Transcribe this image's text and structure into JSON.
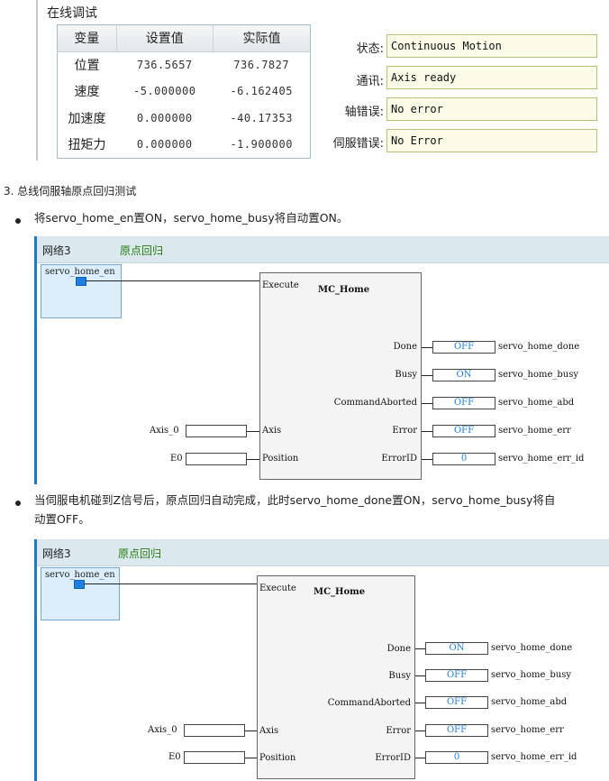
{
  "online": {
    "title": "在线调试",
    "table": {
      "headers": [
        "变量",
        "设置值",
        "实际值"
      ],
      "rows": [
        {
          "name": "位置",
          "set": "736.5657",
          "actual": "736.7827"
        },
        {
          "name": "速度",
          "set": "-5.000000",
          "actual": "-6.162405"
        },
        {
          "name": "加速度",
          "set": "0.000000",
          "actual": "-40.17353"
        },
        {
          "name": "扭矩力",
          "set": "0.000000",
          "actual": "-1.900000"
        }
      ]
    },
    "status": [
      {
        "label": "状态:",
        "value": "Continuous Motion"
      },
      {
        "label": "通讯:",
        "value": "Axis ready"
      },
      {
        "label": "轴错误:",
        "value": "No error"
      },
      {
        "label": "伺服错误:",
        "value": "No Error"
      }
    ]
  },
  "section3_heading": "3. 总线伺服轴原点回归测试",
  "bullets": [
    "将servo_home_en置ON，servo_home_busy将自动置ON。",
    "当伺服电机碰到Z信号后，原点回归自动完成，此时servo_home_done置ON，servo_home_busy将自",
    "动置OFF。"
  ],
  "diagrams": [
    {
      "network": "网络3",
      "comment": "原点回归",
      "contact": "servo_home_en",
      "block_name": "MC_Home",
      "execute_pin": "Execute",
      "inputs": [
        {
          "pin": "Axis",
          "var": "Axis_0"
        },
        {
          "pin": "Position",
          "var": "E0"
        }
      ],
      "outputs": [
        {
          "pin": "Done",
          "value": "OFF",
          "var": "servo_home_done"
        },
        {
          "pin": "Busy",
          "value": "ON",
          "var": "servo_home_busy"
        },
        {
          "pin": "CommandAborted",
          "value": "OFF",
          "var": "servo_home_abd"
        },
        {
          "pin": "Error",
          "value": "OFF",
          "var": "servo_home_err"
        },
        {
          "pin": "ErrorID",
          "value": "0",
          "var": "servo_home_err_id"
        }
      ]
    },
    {
      "network": "网络3",
      "comment": "原点回归",
      "contact": "servo_home_en",
      "block_name": "MC_Home",
      "execute_pin": "Execute",
      "inputs": [
        {
          "pin": "Axis",
          "var": "Axis_0"
        },
        {
          "pin": "Position",
          "var": "E0"
        }
      ],
      "outputs": [
        {
          "pin": "Done",
          "value": "ON",
          "var": "servo_home_done"
        },
        {
          "pin": "Busy",
          "value": "OFF",
          "var": "servo_home_busy"
        },
        {
          "pin": "CommandAborted",
          "value": "OFF",
          "var": "servo_home_abd"
        },
        {
          "pin": "Error",
          "value": "OFF",
          "var": "servo_home_err"
        },
        {
          "pin": "ErrorID",
          "value": "0",
          "var": "servo_home_err_id"
        }
      ]
    }
  ],
  "colors": {
    "rail": "#1b78c8",
    "header_bg": "#dbe9ef",
    "comment": "#2a7a12",
    "output_value": "#1f7fe0",
    "contact_fill": "#1f7fe0"
  }
}
